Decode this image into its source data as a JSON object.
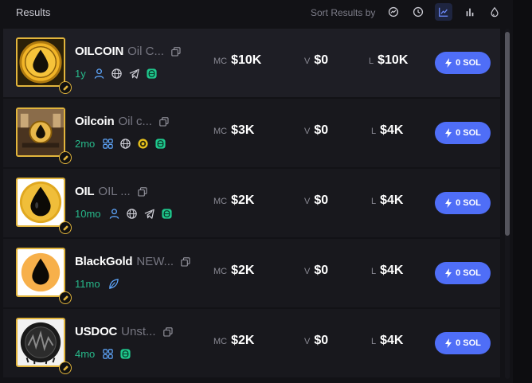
{
  "header": {
    "title": "Results",
    "sort_label": "Sort Results by",
    "sort_options": [
      "trending-icon",
      "clock-icon",
      "chart-line-icon",
      "bar-chart-icon",
      "droplet-icon"
    ],
    "active_sort": "chart-line-icon"
  },
  "stat_labels": {
    "mc": "MC",
    "v": "V",
    "l": "L"
  },
  "rows": [
    {
      "symbol": "OILCOIN",
      "name": "Oil C...",
      "age": "1y",
      "icons": [
        "person-icon",
        "globe-icon",
        "telegram-icon",
        "pump-icon"
      ],
      "mc": "$10K",
      "v": "$0",
      "l": "$10K",
      "buy": "0 SOL"
    },
    {
      "symbol": "Oilcoin",
      "name": "Oil c...",
      "age": "2mo",
      "icons": [
        "community-icon",
        "globe-icon",
        "coin-icon",
        "pump-icon"
      ],
      "mc": "$3K",
      "v": "$0",
      "l": "$4K",
      "buy": "0 SOL"
    },
    {
      "symbol": "OIL",
      "name": "OIL ...",
      "age": "10mo",
      "icons": [
        "person-icon",
        "globe-icon",
        "telegram-icon",
        "pump-icon"
      ],
      "mc": "$2K",
      "v": "$0",
      "l": "$4K",
      "buy": "0 SOL"
    },
    {
      "symbol": "BlackGold",
      "name": "NEW...",
      "age": "11mo",
      "icons": [
        "leaf-icon"
      ],
      "mc": "$2K",
      "v": "$0",
      "l": "$4K",
      "buy": "0 SOL"
    },
    {
      "symbol": "USDOC",
      "name": "Unst...",
      "age": "4mo",
      "icons": [
        "community-icon",
        "pump-icon"
      ],
      "mc": "$2K",
      "v": "$0",
      "l": "$4K",
      "buy": "0 SOL"
    }
  ],
  "colors": {
    "accent": "#4f6ef7",
    "age": "#27b98a",
    "badge": "#e2b53c"
  }
}
